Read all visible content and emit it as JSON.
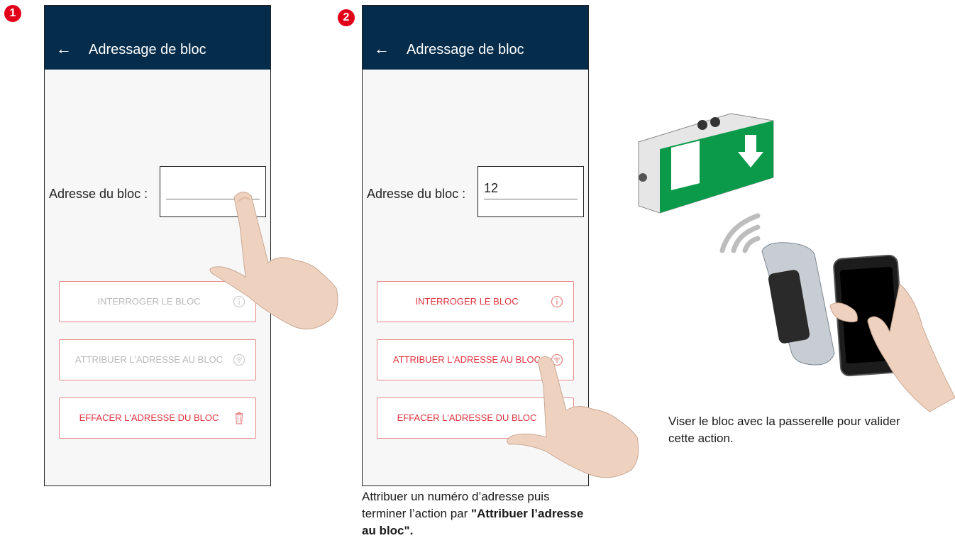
{
  "steps": [
    {
      "badge": "1",
      "screen": {
        "back_icon": "arrow-left-icon",
        "title": "Adressage de bloc",
        "field_label": "Adresse du bloc :",
        "field_value": "",
        "buttons": [
          {
            "label": "INTERROGER LE BLOC",
            "icon": "info-icon",
            "state": "disabled"
          },
          {
            "label": "ATTRIBUER L'ADRESSE AU BLOC",
            "icon": "wifi-icon",
            "state": "disabled"
          },
          {
            "label": "EFFACER L'ADRESSE DU BLOC",
            "icon": "trash-icon",
            "state": "active"
          }
        ]
      }
    },
    {
      "badge": "2",
      "screen": {
        "back_icon": "arrow-left-icon",
        "title": "Adressage de bloc",
        "field_label": "Adresse du bloc :",
        "field_value": "12",
        "buttons": [
          {
            "label": "INTERROGER LE BLOC",
            "icon": "info-icon",
            "state": "active"
          },
          {
            "label": "ATTRIBUER L'ADRESSE AU BLOC",
            "icon": "wifi-icon",
            "state": "active"
          },
          {
            "label": "EFFACER L'ADRESSE DU BLOC",
            "icon": "trash-icon",
            "state": "active"
          }
        ]
      }
    }
  ],
  "captions": {
    "step2_normal": "Attribuer un numéro d’adresse puis terminer l’action par ",
    "step2_bold": "\"Attribuer l’adresse au bloc\".",
    "step3": "Viser le bloc avec la passerelle pour valider cette action."
  },
  "colors": {
    "appbar": "#052c4a",
    "badge": "#e2001a",
    "button_border": "#e98a8a",
    "button_text_active": "#e0333f",
    "button_text_disabled": "#b9b9b9",
    "exit_sign_green": "#0a9a4a"
  }
}
